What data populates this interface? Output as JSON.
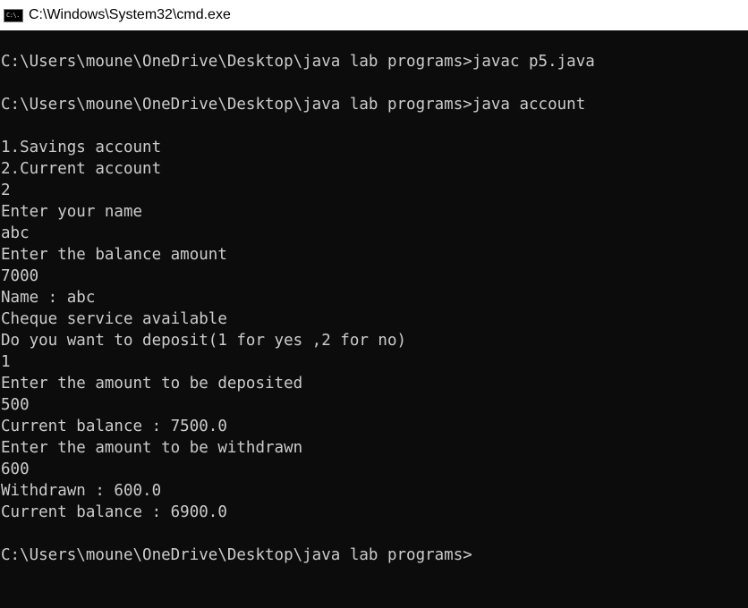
{
  "window": {
    "title": "C:\\Windows\\System32\\cmd.exe",
    "icon": "cmd-app-icon",
    "icon_glyph": "C:\\."
  },
  "console": {
    "lines": [
      "C:\\Users\\moune\\OneDrive\\Desktop\\java lab programs>javac p5.java",
      "",
      "C:\\Users\\moune\\OneDrive\\Desktop\\java lab programs>java account",
      "",
      "1.Savings account",
      "2.Current account",
      "2",
      "Enter your name",
      "abc",
      "Enter the balance amount",
      "7000",
      "Name : abc",
      "Cheque service available",
      "Do you want to deposit(1 for yes ,2 for no)",
      "1",
      "Enter the amount to be deposited",
      "500",
      "Current balance : 7500.0",
      "Enter the amount to be withdrawn",
      "600",
      "Withdrawn : 600.0",
      "Current balance : 6900.0",
      "",
      "C:\\Users\\moune\\OneDrive\\Desktop\\java lab programs>"
    ]
  },
  "colors": {
    "background": "#0c0c0c",
    "text": "#cccccc",
    "titlebar": "#ffffff"
  }
}
